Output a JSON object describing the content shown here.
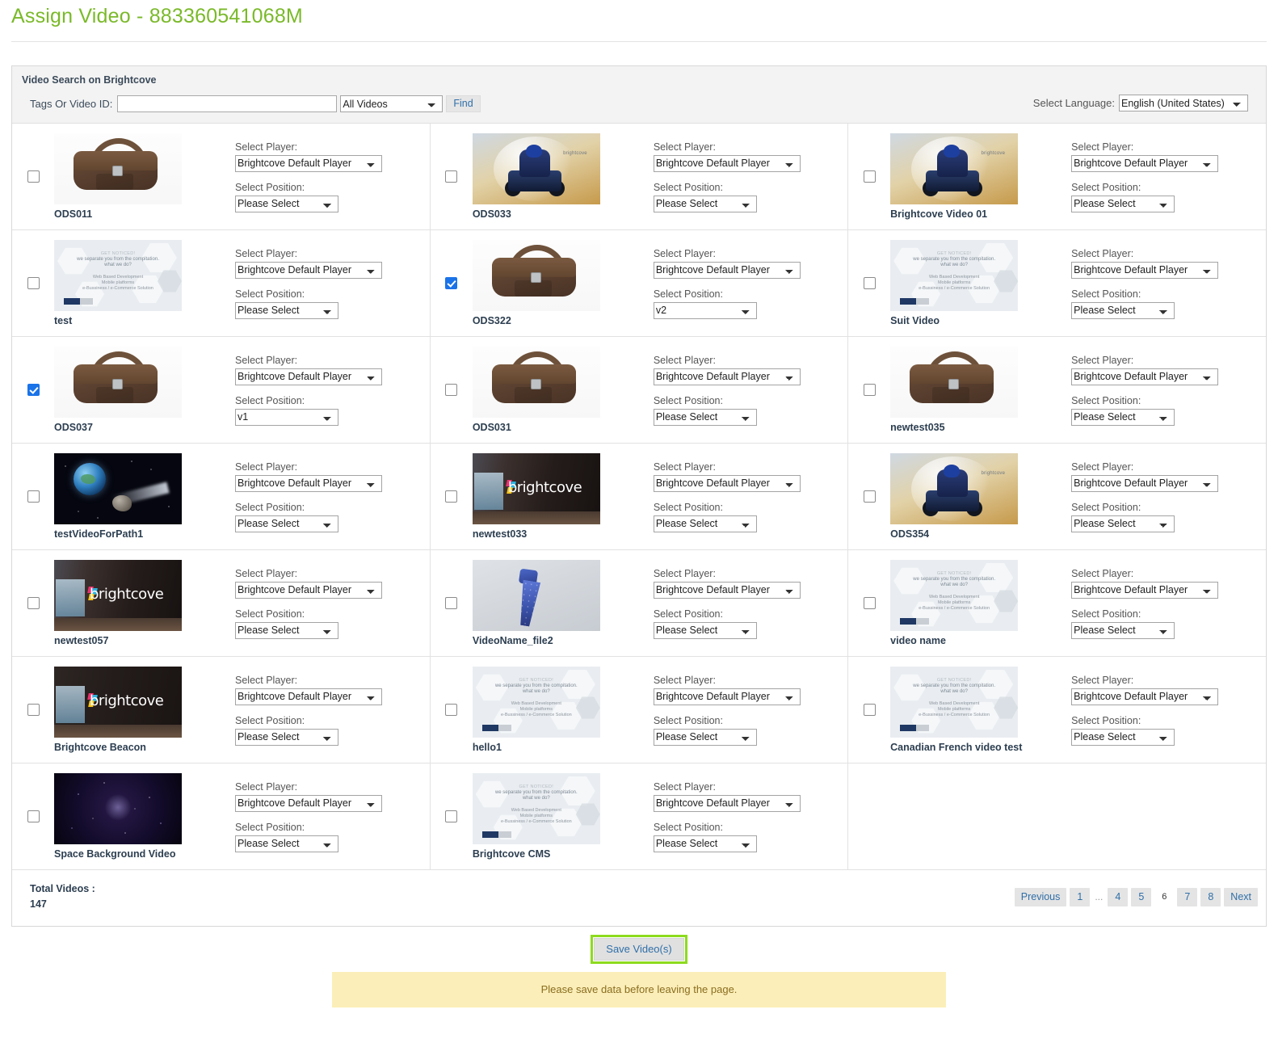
{
  "page": {
    "title": "Assign Video - 883360541068M",
    "title_color": "#7ab929"
  },
  "panel": {
    "heading": "Video Search on Brightcove",
    "search": {
      "label": "Tags Or Video ID:",
      "value": "",
      "placeholder": "",
      "scope_selected": "All Videos",
      "scope_options": [
        "All Videos"
      ],
      "find_label": "Find"
    },
    "language": {
      "label": "Select Language:",
      "selected": "English (United States)",
      "options": [
        "English (United States)"
      ]
    }
  },
  "labels": {
    "select_player": "Select Player:",
    "select_position": "Select Position:",
    "default_player": "Brightcove Default Player",
    "please_select": "Please Select"
  },
  "videos": [
    {
      "name": "ODS011",
      "thumb": "bag",
      "checked": false,
      "player": "Brightcove Default Player",
      "position": "Please Select"
    },
    {
      "name": "ODS033",
      "thumb": "atv",
      "checked": false,
      "player": "Brightcove Default Player",
      "position": "Please Select"
    },
    {
      "name": "Brightcove Video 01",
      "thumb": "atv",
      "checked": false,
      "player": "Brightcove Default Player",
      "position": "Please Select"
    },
    {
      "name": "test",
      "thumb": "notice",
      "checked": false,
      "player": "Brightcove Default Player",
      "position": "Please Select"
    },
    {
      "name": "ODS322",
      "thumb": "bag",
      "checked": true,
      "player": "Brightcove Default Player",
      "position": "v2"
    },
    {
      "name": "Suit Video",
      "thumb": "notice",
      "checked": false,
      "player": "Brightcove Default Player",
      "position": "Please Select"
    },
    {
      "name": "ODS037",
      "thumb": "bag",
      "checked": true,
      "player": "Brightcove Default Player",
      "position": "v1"
    },
    {
      "name": "ODS031",
      "thumb": "bag",
      "checked": false,
      "player": "Brightcove Default Player",
      "position": "Please Select"
    },
    {
      "name": "newtest035",
      "thumb": "bag",
      "checked": false,
      "player": "Brightcove Default Player",
      "position": "Please Select"
    },
    {
      "name": "testVideoForPath1",
      "thumb": "space",
      "checked": false,
      "player": "Brightcove Default Player",
      "position": "Please Select"
    },
    {
      "name": "newtest033",
      "thumb": "office",
      "checked": false,
      "player": "Brightcove Default Player",
      "position": "Please Select"
    },
    {
      "name": "ODS354",
      "thumb": "atv",
      "checked": false,
      "player": "Brightcove Default Player",
      "position": "Please Select"
    },
    {
      "name": "newtest057",
      "thumb": "office",
      "checked": false,
      "player": "Brightcove Default Player",
      "position": "Please Select"
    },
    {
      "name": "VideoName_file2",
      "thumb": "tie",
      "checked": false,
      "player": "Brightcove Default Player",
      "position": "Please Select"
    },
    {
      "name": "video name",
      "thumb": "notice",
      "checked": false,
      "player": "Brightcove Default Player",
      "position": "Please Select"
    },
    {
      "name": "Brightcove Beacon",
      "thumb": "office-dark",
      "checked": false,
      "player": "Brightcove Default Player",
      "position": "Please Select"
    },
    {
      "name": "hello1",
      "thumb": "notice",
      "checked": false,
      "player": "Brightcove Default Player",
      "position": "Please Select"
    },
    {
      "name": "Canadian French video test",
      "thumb": "notice",
      "checked": false,
      "player": "Brightcove Default Player",
      "position": "Please Select"
    },
    {
      "name": "Space Background Video",
      "thumb": "burst",
      "checked": false,
      "player": "Brightcove Default Player",
      "position": "Please Select"
    },
    {
      "name": "Brightcove CMS",
      "thumb": "notice",
      "checked": false,
      "player": "Brightcove Default Player",
      "position": "Please Select"
    }
  ],
  "thumbnail_text": {
    "notice_line0": "GET NOTICED!",
    "notice_line1": "we separate you from the compitation.",
    "notice_line1b": "what we do?",
    "notice_line2": "Web Based Development",
    "notice_line3": "Mobile platforms",
    "notice_line4": "e-Bussiness / e-Commerce Solution",
    "office_logo": "brightcove",
    "atv_logo": "brightcove"
  },
  "footer": {
    "total_label": "Total Videos :",
    "total_value": "147",
    "pagination": {
      "previous": "Previous",
      "next": "Next",
      "ellipsis": "...",
      "pages": [
        "1",
        "4",
        "5",
        "6",
        "7",
        "8"
      ],
      "current": "6"
    },
    "save_label": "Save Video(s)",
    "save_highlight_color": "#8ddb1e",
    "notice_message": "Please save data before leaving the page."
  }
}
